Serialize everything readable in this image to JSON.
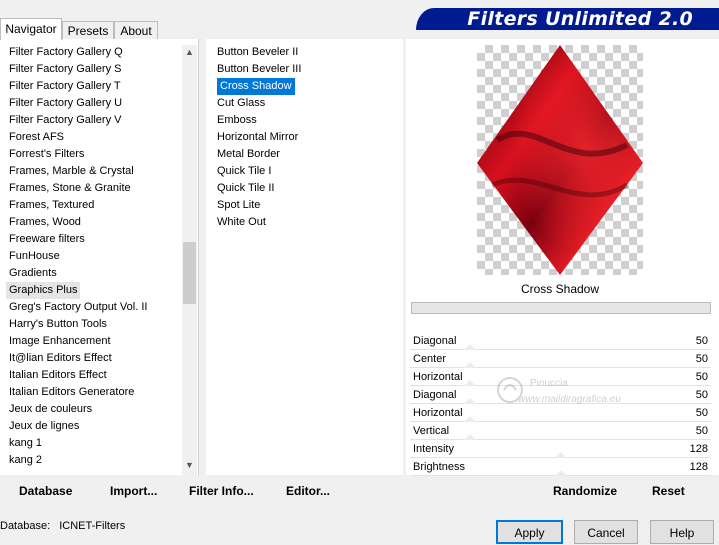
{
  "tabs": [
    {
      "label": "Navigator",
      "active": true
    },
    {
      "label": "Presets",
      "active": false
    },
    {
      "label": "About",
      "active": false
    }
  ],
  "banner": {
    "title": "Filters Unlimited 2.0",
    "color": "#001a8f"
  },
  "categories": {
    "items": [
      "Filter Factory Gallery Q",
      "Filter Factory Gallery S",
      "Filter Factory Gallery T",
      "Filter Factory Gallery U",
      "Filter Factory Gallery V",
      "Forest AFS",
      "Forrest's Filters",
      "Frames, Marble & Crystal",
      "Frames, Stone & Granite",
      "Frames, Textured",
      "Frames, Wood",
      "Freeware filters",
      "FunHouse",
      "Gradients",
      "Graphics Plus",
      "Greg's Factory Output Vol. II",
      "Harry's Button Tools",
      "Image Enhancement",
      "It@lian Editors Effect",
      "Italian Editors Effect",
      "Italian Editors Generatore",
      "Jeux de couleurs",
      "Jeux de lignes",
      "kang 1",
      "kang 2"
    ],
    "selected": "Graphics Plus",
    "scroll_position": 0.45
  },
  "filters": {
    "items": [
      "Button Beveler II",
      "Button Beveler III",
      "Cross Shadow",
      "Cut Glass",
      "Emboss",
      "Horizontal Mirror",
      "Metal Border",
      "Quick Tile I",
      "Quick Tile II",
      "Spot Lite",
      "White Out"
    ],
    "selected": "Cross Shadow",
    "selected_color": "#0078d7"
  },
  "preview": {
    "filter_name": "Cross Shadow"
  },
  "sliders": [
    {
      "label": "Diagonal",
      "value": "50",
      "level": 0.2
    },
    {
      "label": "Center",
      "value": "50",
      "level": 0.2
    },
    {
      "label": "Horizontal",
      "value": "50",
      "level": 0.2
    },
    {
      "label": "Diagonal",
      "value": "50",
      "level": 0.2
    },
    {
      "label": "Horizontal",
      "value": "50",
      "level": 0.2
    },
    {
      "label": "Vertical",
      "value": "50",
      "level": 0.2
    },
    {
      "label": "Intensity",
      "value": "128",
      "level": 0.5
    },
    {
      "label": "Brightness",
      "value": "128",
      "level": 0.5
    }
  ],
  "watermark": {
    "name": "Pinuccia",
    "url": "www.maildiragrafica.eu"
  },
  "actions": {
    "database": "Database",
    "import": "Import...",
    "filter_info": "Filter Info...",
    "editor": "Editor...",
    "randomize": "Randomize",
    "reset": "Reset"
  },
  "status": {
    "database_label": "Database:",
    "database_value": "ICNET-Filters"
  },
  "dialog_buttons": {
    "apply": "Apply",
    "cancel": "Cancel",
    "help": "Help"
  }
}
